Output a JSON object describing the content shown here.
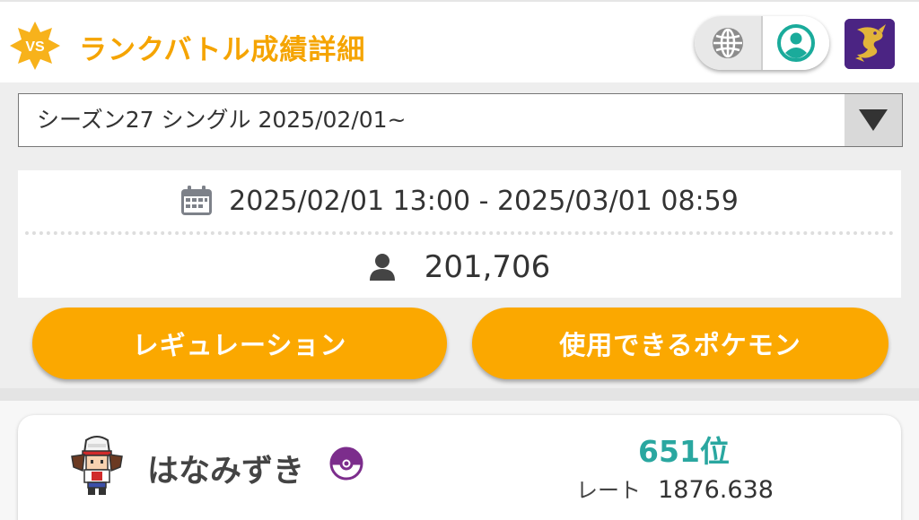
{
  "header": {
    "badge_text": "VS",
    "title": "ランクバトル成績詳細",
    "language_icon": "globe-icon",
    "account_icon": "user-circle-icon",
    "avatar_icon": "dragon-avatar-icon"
  },
  "season_select": {
    "selected": "シーズン27 シングル 2025/02/01~"
  },
  "info": {
    "period": "2025/02/01 13:00 - 2025/03/01 08:59",
    "players": "201,706"
  },
  "buttons": {
    "regulation": "レギュレーション",
    "usable_pokemon": "使用できるポケモン"
  },
  "ranking": {
    "name": "はなみずき",
    "rank": "651位",
    "rate_label": "レート",
    "rate_value": "1876.638"
  },
  "colors": {
    "accent_orange": "#fba800",
    "title_orange": "#f5a400",
    "rank_teal": "#2aa7a0",
    "account_teal": "#1aab9b",
    "ball_purple": "#7c2d8c"
  }
}
